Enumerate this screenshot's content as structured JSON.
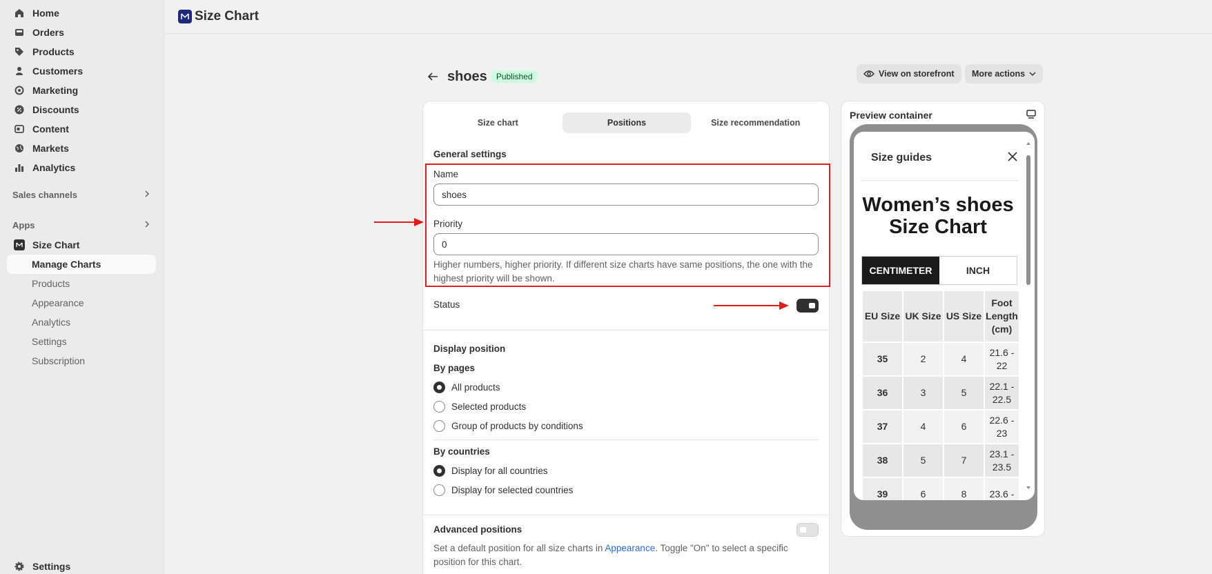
{
  "sidebar": {
    "main_items": [
      {
        "label": "Home",
        "icon": "home-icon"
      },
      {
        "label": "Orders",
        "icon": "inbox-icon"
      },
      {
        "label": "Products",
        "icon": "tag-icon"
      },
      {
        "label": "Customers",
        "icon": "person-icon"
      },
      {
        "label": "Marketing",
        "icon": "target-icon"
      },
      {
        "label": "Discounts",
        "icon": "discount-icon"
      },
      {
        "label": "Content",
        "icon": "content-icon"
      },
      {
        "label": "Markets",
        "icon": "globe-icon"
      },
      {
        "label": "Analytics",
        "icon": "bar-chart-icon"
      }
    ],
    "sales_channels_label": "Sales channels",
    "apps_label": "Apps",
    "app_name": "Size Chart",
    "app_items": [
      {
        "label": "Manage Charts"
      },
      {
        "label": "Products"
      },
      {
        "label": "Appearance"
      },
      {
        "label": "Analytics"
      },
      {
        "label": "Settings"
      },
      {
        "label": "Subscription"
      }
    ],
    "settings_label": "Settings"
  },
  "topbar": {
    "title": "Size Chart"
  },
  "page": {
    "title": "shoes",
    "badge": "Published",
    "view_storefront": "View on storefront",
    "more_actions": "More actions"
  },
  "tabs": [
    {
      "label": "Size chart",
      "active": false
    },
    {
      "label": "Positions",
      "active": true
    },
    {
      "label": "Size recommendation",
      "active": false
    }
  ],
  "form": {
    "general_settings": "General settings",
    "name_label": "Name",
    "name_value": "shoes",
    "priority_label": "Priority",
    "priority_value": "0",
    "priority_help": "Higher numbers, higher priority. If different size charts have same positions, the one with the highest priority will be shown.",
    "status_label": "Status",
    "status_on": true,
    "display_position": "Display position",
    "by_pages": "By pages",
    "page_options": [
      {
        "label": "All products",
        "checked": true
      },
      {
        "label": "Selected products",
        "checked": false
      },
      {
        "label": "Group of products by conditions",
        "checked": false
      }
    ],
    "by_countries": "By countries",
    "country_options": [
      {
        "label": "Display for all countries",
        "checked": true
      },
      {
        "label": "Display for selected countries",
        "checked": false
      }
    ],
    "advanced_positions": "Advanced positions",
    "advanced_on": false,
    "advanced_help_before": "Set a default position for all size charts in ",
    "advanced_help_link": "Appearance",
    "advanced_help_after": ". Toggle \"On\" to select a specific position for this chart."
  },
  "preview": {
    "title": "Preview container",
    "modal_title": "Size guides",
    "heading": "Women’s shoes Size Chart",
    "units": [
      "CENTIMETER",
      "INCH"
    ],
    "active_unit": "CENTIMETER",
    "columns": [
      "EU Size",
      "UK Size",
      "US Size",
      "Foot Length (cm)"
    ],
    "rows": [
      [
        "35",
        "2",
        "4",
        "21.6 - 22"
      ],
      [
        "36",
        "3",
        "5",
        "22.1 - 22.5"
      ],
      [
        "37",
        "4",
        "6",
        "22.6 - 23"
      ],
      [
        "38",
        "5",
        "7",
        "23.1 - 23.5"
      ],
      [
        "39",
        "6",
        "8",
        "23.6 -"
      ]
    ]
  },
  "colors": {
    "annotation_red": "#e51c1c",
    "badge_bg": "#cdfee1",
    "link": "#2c6ecb",
    "app_logo": "#1e2a78"
  }
}
